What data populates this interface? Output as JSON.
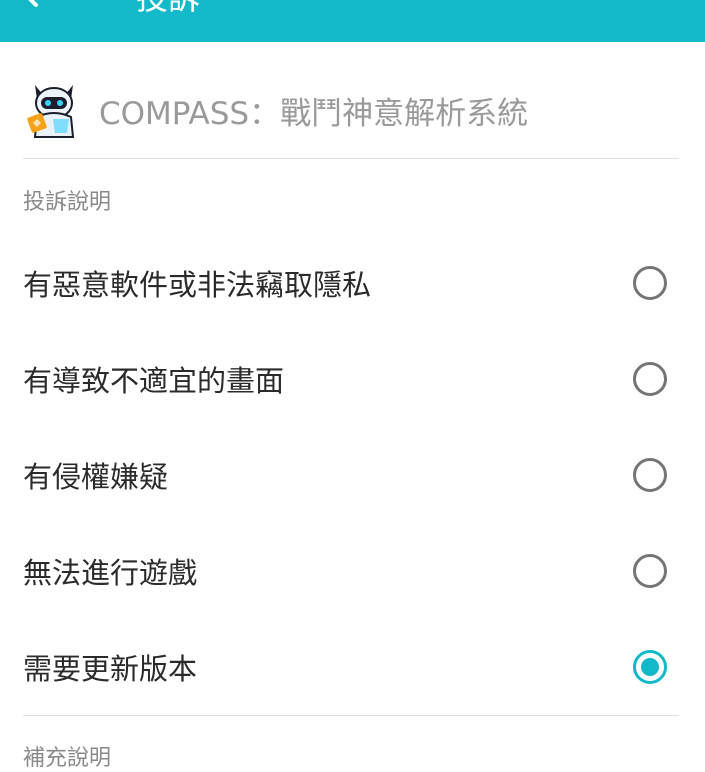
{
  "header": {
    "title": "投訴",
    "back_icon": "arrow-back-icon",
    "background": "#13b9c9"
  },
  "app": {
    "name": "COMPASS：戰鬥神意解析系統",
    "icon": "app-icon"
  },
  "report_section": {
    "label": "投訴說明",
    "options": [
      {
        "label": "有惡意軟件或非法竊取隱私",
        "selected": false
      },
      {
        "label": "有導致不適宜的畫面",
        "selected": false
      },
      {
        "label": "有侵權嫌疑",
        "selected": false
      },
      {
        "label": "無法進行遊戲",
        "selected": false
      },
      {
        "label": "需要更新版本",
        "selected": true
      }
    ]
  },
  "extra_section": {
    "label": "補充說明"
  },
  "colors": {
    "accent": "#13b9c9",
    "radio_unchecked": "#757575"
  }
}
